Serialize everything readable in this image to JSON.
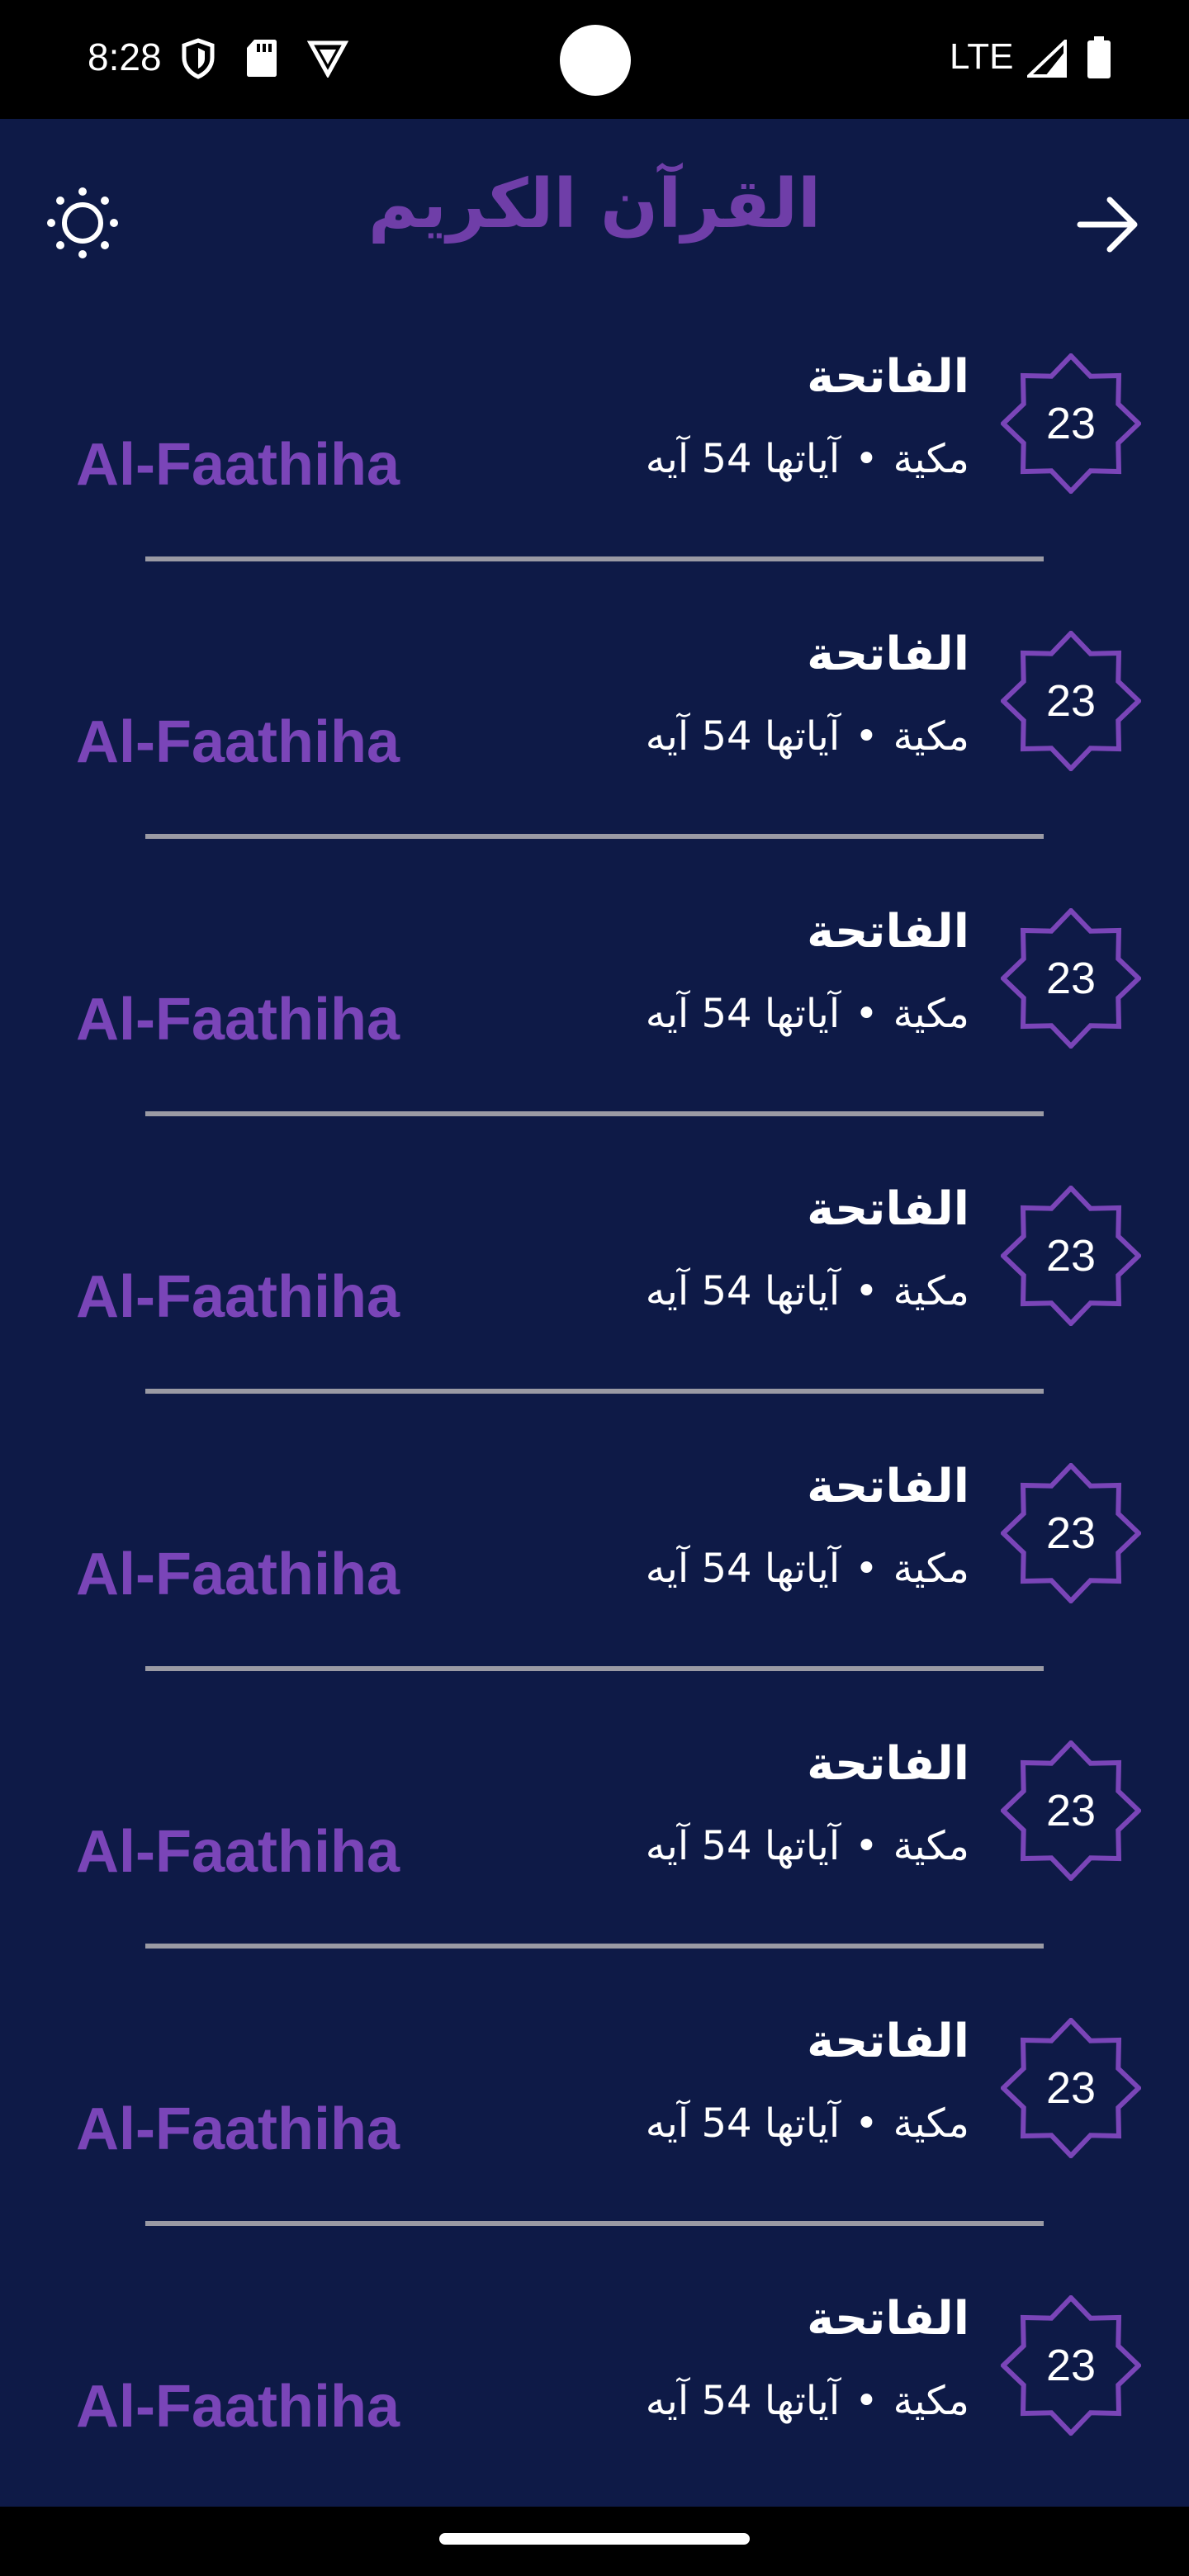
{
  "status_bar": {
    "time": "8:28",
    "network": "LTE",
    "icons": [
      "shield-icon",
      "sd-card-icon",
      "vpn-icon",
      "signal-icon",
      "battery-icon"
    ]
  },
  "app_bar": {
    "title": "القرآن الكريم",
    "left_icon": "brightness-icon",
    "right_icon": "arrow-forward-icon"
  },
  "colors": {
    "background": "#0e1a47",
    "accent": "#7a45b8",
    "text": "#ffffff",
    "divider": "#9a9aa4"
  },
  "surahs": [
    {
      "number": "23",
      "name_ar": "الفاتحة",
      "type": "مكية",
      "ayah_count": "آياتها 54 آيه",
      "name_en": "Al-Faathiha"
    },
    {
      "number": "23",
      "name_ar": "الفاتحة",
      "type": "مكية",
      "ayah_count": "آياتها 54 آيه",
      "name_en": "Al-Faathiha"
    },
    {
      "number": "23",
      "name_ar": "الفاتحة",
      "type": "مكية",
      "ayah_count": "آياتها 54 آيه",
      "name_en": "Al-Faathiha"
    },
    {
      "number": "23",
      "name_ar": "الفاتحة",
      "type": "مكية",
      "ayah_count": "آياتها 54 آيه",
      "name_en": "Al-Faathiha"
    },
    {
      "number": "23",
      "name_ar": "الفاتحة",
      "type": "مكية",
      "ayah_count": "آياتها 54 آيه",
      "name_en": "Al-Faathiha"
    },
    {
      "number": "23",
      "name_ar": "الفاتحة",
      "type": "مكية",
      "ayah_count": "آياتها 54 آيه",
      "name_en": "Al-Faathiha"
    },
    {
      "number": "23",
      "name_ar": "الفاتحة",
      "type": "مكية",
      "ayah_count": "آياتها 54 آيه",
      "name_en": "Al-Faathiha"
    },
    {
      "number": "23",
      "name_ar": "الفاتحة",
      "type": "مكية",
      "ayah_count": "آياتها 54 آيه",
      "name_en": "Al-Faathiha"
    }
  ]
}
